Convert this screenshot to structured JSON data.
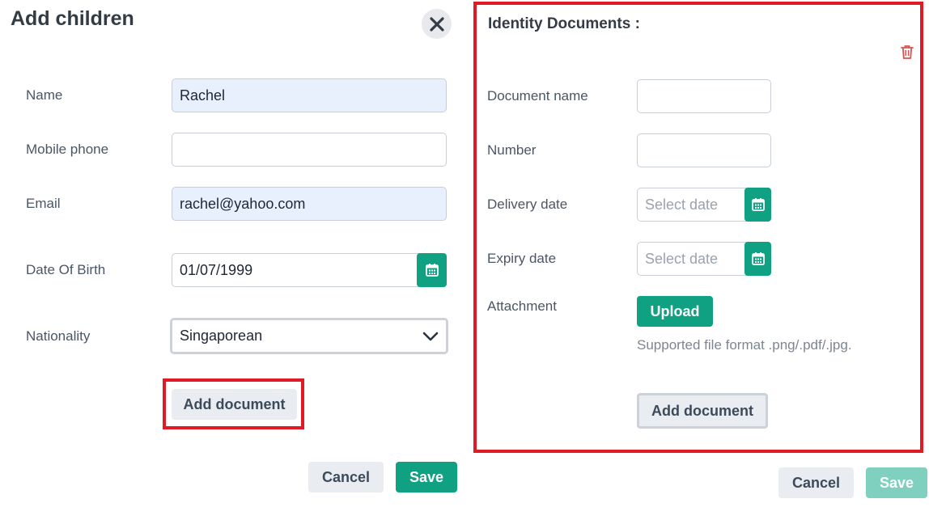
{
  "left_panel": {
    "title": "Add children",
    "fields": {
      "name": {
        "label": "Name",
        "value": "Rachel"
      },
      "mobile": {
        "label": "Mobile phone",
        "value": ""
      },
      "email": {
        "label": "Email",
        "value": "rachel@yahoo.com"
      },
      "dob": {
        "label": "Date Of Birth",
        "value": "01/07/1999"
      },
      "nationality": {
        "label": "Nationality",
        "value": "Singaporean"
      }
    },
    "add_document_label": "Add document",
    "cancel_label": "Cancel",
    "save_label": "Save"
  },
  "right_panel": {
    "title": "Identity Documents :",
    "fields": {
      "document_name": {
        "label": "Document name",
        "value": ""
      },
      "number": {
        "label": "Number",
        "value": ""
      },
      "delivery_date": {
        "label": "Delivery date",
        "placeholder": "Select date"
      },
      "expiry_date": {
        "label": "Expiry date",
        "placeholder": "Select date"
      },
      "attachment": {
        "label": "Attachment"
      }
    },
    "upload_label": "Upload",
    "supported_note": "Supported file format .png/.pdf/.jpg.",
    "add_document_label": "Add document",
    "cancel_label": "Cancel",
    "save_label": "Save"
  },
  "colors": {
    "accent": "#10a183",
    "highlight": "#e01b24",
    "delete": "#d9534f"
  },
  "icons": [
    "close-icon",
    "calendar-icon",
    "trash-icon",
    "chevron-down-icon"
  ]
}
